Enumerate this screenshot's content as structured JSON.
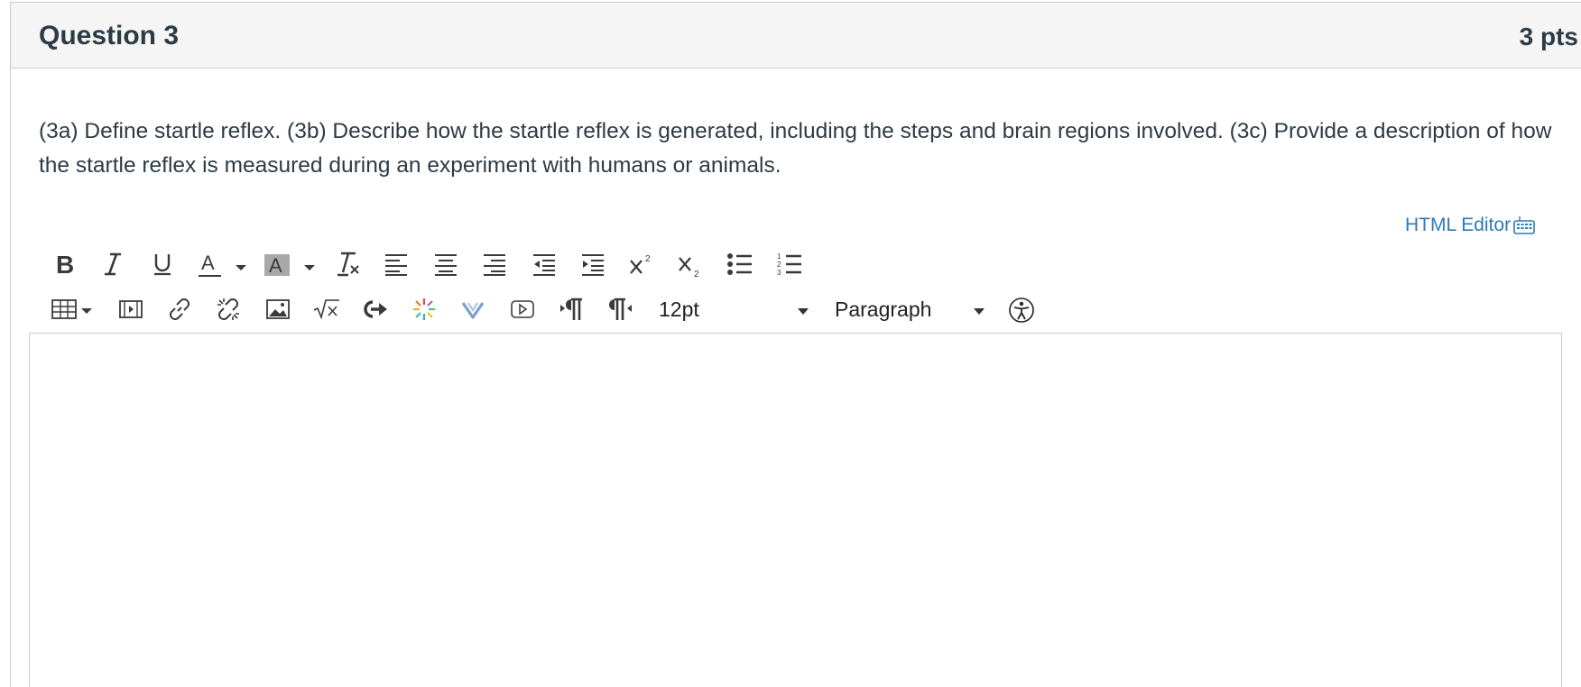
{
  "question": {
    "title": "Question 3",
    "points": "3 pts",
    "text": "(3a) Define startle reflex. (3b) Describe how the startle reflex is generated, including the steps and brain regions involved. (3c) Provide a description of how the startle reflex is measured during an experiment with humans or animals."
  },
  "editor": {
    "html_editor_label": "HTML Editor",
    "font_size_value": "12pt",
    "block_format_value": "Paragraph",
    "content": ""
  },
  "toolbar_row1_icons": [
    "bold-icon",
    "italic-icon",
    "underline-icon",
    "text-color-icon",
    "background-color-icon",
    "clear-formatting-icon",
    "align-left-icon",
    "align-center-icon",
    "align-right-icon",
    "outdent-icon",
    "indent-icon",
    "superscript-icon",
    "subscript-icon",
    "bullet-list-icon",
    "numbered-list-icon"
  ],
  "toolbar_row2_icons": [
    "table-icon",
    "media-icon",
    "link-icon",
    "unlink-icon",
    "image-icon",
    "equation-icon",
    "share-icon",
    "apps-icon",
    "vimeo-icon",
    "video-icon",
    "ltr-icon",
    "rtl-icon",
    "accessibility-icon"
  ],
  "colors": {
    "header_bg": "#f5f5f5",
    "text": "#2d3b45",
    "link": "#2b7abc",
    "border": "#c7cdd1",
    "highlight_swatch": "#a9a9a9"
  }
}
